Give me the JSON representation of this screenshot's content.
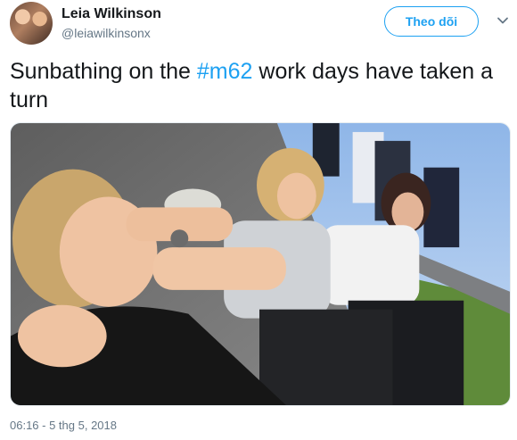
{
  "user": {
    "name": "Leia Wilkinson",
    "handle": "@leiawilkinsonx"
  },
  "follow_button": {
    "label": "Theo dõi"
  },
  "tweet": {
    "text_before": "Sunbathing on the ",
    "hashtag": "#m62",
    "text_after": " work days have taken a turn"
  },
  "timestamp": "06:16 - 5 thg 5, 2018",
  "colors": {
    "accent": "#1da1f2",
    "text": "#14171a",
    "muted": "#657786"
  },
  "icons": {
    "more": "chevron-down-icon"
  }
}
